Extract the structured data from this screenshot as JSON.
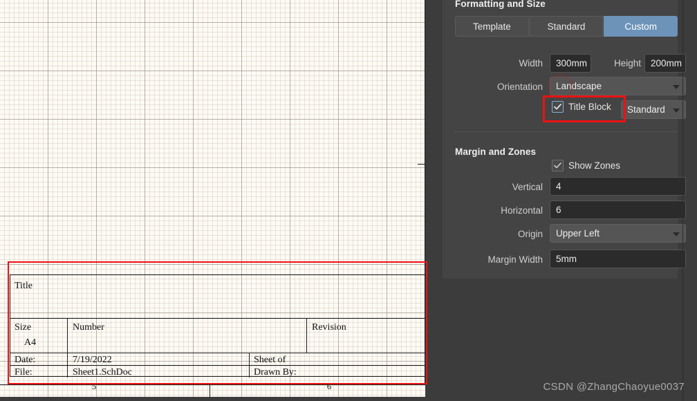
{
  "canvas": {
    "zone_labels": [
      "5",
      "6"
    ],
    "title_block": {
      "title_label": "Title",
      "size_label": "Size",
      "size_value": "A4",
      "number_label": "Number",
      "revision_label": "Revision",
      "date_label": "Date:",
      "date_value": "7/19/2022",
      "sheet_label": "Sheet  of",
      "file_label": "File:",
      "file_value": "Sheet1.SchDoc",
      "drawn_by_label": "Drawn By:"
    }
  },
  "panel": {
    "formatting": {
      "section_title": "Formatting and Size",
      "tabs": [
        {
          "label": "Template",
          "active": false
        },
        {
          "label": "Standard",
          "active": false
        },
        {
          "label": "Custom",
          "active": true
        }
      ],
      "width_label": "Width",
      "width_value": "300mm",
      "height_label": "Height",
      "height_value": "200mm",
      "orientation_label": "Orientation",
      "orientation_value": "Landscape",
      "title_block_label": "Title Block",
      "title_block_checked": true,
      "title_block_style_value": "Standard"
    },
    "margin": {
      "section_title": "Margin and Zones",
      "show_zones_label": "Show Zones",
      "show_zones_checked": true,
      "vertical_label": "Vertical",
      "vertical_value": "4",
      "horizontal_label": "Horizontal",
      "horizontal_value": "6",
      "origin_label": "Origin",
      "origin_value": "Upper Left",
      "margin_width_label": "Margin Width",
      "margin_width_value": "5mm"
    }
  },
  "watermark": {
    "text": "CSDN @ZhangChaoyue0037"
  },
  "colors": {
    "accent_selected": "#6d93b8",
    "annotation_red": "#ee1111",
    "panel_bg": "#3c3c3c",
    "card_bg": "#444444",
    "canvas_bg": "#fdfaf4"
  }
}
